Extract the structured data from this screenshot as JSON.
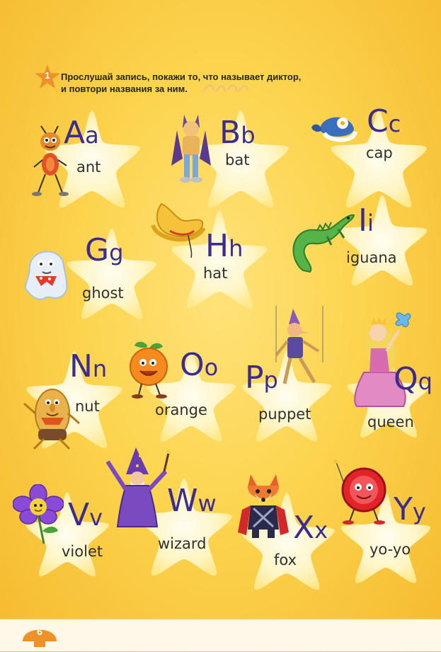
{
  "exercise": {
    "number": "1",
    "instruction_line1": "Прослушай запись, покажи то, что называет диктор,",
    "instruction_line2": "и повтори названия за ним."
  },
  "page_number": "6",
  "cards": [
    {
      "id": "a",
      "upper": "A",
      "lower": "a",
      "word": "ant",
      "icon": "ant-icon"
    },
    {
      "id": "b",
      "upper": "B",
      "lower": "b",
      "word": "bat",
      "icon": "bat-icon"
    },
    {
      "id": "c",
      "upper": "C",
      "lower": "c",
      "word": "cap",
      "icon": "cap-icon"
    },
    {
      "id": "g",
      "upper": "G",
      "lower": "g",
      "word": "ghost",
      "icon": "ghost-icon"
    },
    {
      "id": "h",
      "upper": "H",
      "lower": "h",
      "word": "hat",
      "icon": "hat-icon"
    },
    {
      "id": "i",
      "upper": "I",
      "lower": "i",
      "word": "iguana",
      "icon": "iguana-icon"
    },
    {
      "id": "n",
      "upper": "N",
      "lower": "n",
      "word": "nut",
      "icon": "nut-icon"
    },
    {
      "id": "o",
      "upper": "O",
      "lower": "o",
      "word": "orange",
      "icon": "orange-icon"
    },
    {
      "id": "p",
      "upper": "P",
      "lower": "p",
      "word": "puppet",
      "icon": "puppet-icon"
    },
    {
      "id": "q",
      "upper": "Q",
      "lower": "q",
      "word": "queen",
      "icon": "queen-icon"
    },
    {
      "id": "v",
      "upper": "V",
      "lower": "v",
      "word": "violet",
      "icon": "violet-icon"
    },
    {
      "id": "w",
      "upper": "W",
      "lower": "w",
      "word": "wizard",
      "icon": "wizard-icon"
    },
    {
      "id": "x",
      "upper": "X",
      "lower": "x",
      "word": "fox",
      "icon": "fox-icon"
    },
    {
      "id": "y",
      "upper": "Y",
      "lower": "y",
      "word": "yo-yo",
      "icon": "yo-yo-icon"
    }
  ],
  "colors": {
    "letter": "#3b2d8f",
    "badge": "#f0902a",
    "star": "#fff6c8"
  }
}
